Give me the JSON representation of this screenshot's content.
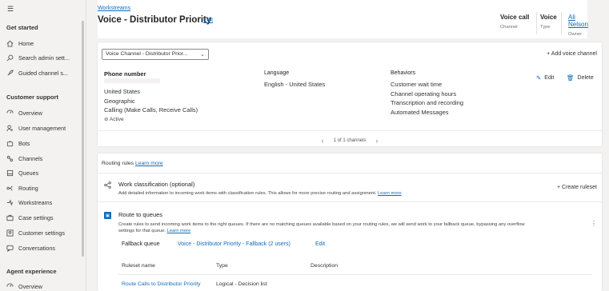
{
  "sidebar": {
    "hamburger": "☰",
    "sections": [
      {
        "title": "Get started",
        "items": [
          {
            "label": "Home",
            "icon": "home-icon"
          },
          {
            "label": "Search admin sett...",
            "icon": "search-icon"
          },
          {
            "label": "Guided channel s...",
            "icon": "rocket-icon"
          }
        ]
      },
      {
        "title": "Customer support",
        "items": [
          {
            "label": "Overview",
            "icon": "overview-icon"
          },
          {
            "label": "User management",
            "icon": "users-icon"
          },
          {
            "label": "Bots",
            "icon": "bot-icon"
          },
          {
            "label": "Channels",
            "icon": "channels-icon"
          },
          {
            "label": "Queues",
            "icon": "queue-icon"
          },
          {
            "label": "Routing",
            "icon": "routing-icon"
          },
          {
            "label": "Workstreams",
            "icon": "workstreams-icon"
          },
          {
            "label": "Case settings",
            "icon": "case-icon"
          },
          {
            "label": "Customer settings",
            "icon": "customer-icon"
          },
          {
            "label": "Conversations",
            "icon": "conversation-icon"
          }
        ]
      },
      {
        "title": "Agent experience",
        "items": [
          {
            "label": "Overview",
            "icon": "overview-icon"
          }
        ]
      }
    ]
  },
  "header": {
    "breadcrumb": "Workstreams",
    "title": "Voice - Distributor Priority",
    "edit_label": "Edit",
    "fields": [
      {
        "value": "Voice call",
        "label": "Channel"
      },
      {
        "value": "Voice",
        "label": "Type"
      },
      {
        "value": "Ali Nelson",
        "label": "Owner"
      }
    ]
  },
  "channel": {
    "dropdown_value": "Voice Channel - Distributor Prior...",
    "add_label": "Add voice channel",
    "phone_heading": "Phone number",
    "phone_lines": [
      "United States",
      "Geographic",
      "Calling (Make Calls, Receive Calls)"
    ],
    "status": "Active",
    "language_heading": "Language",
    "language_value": "English - United States",
    "behaviors_heading": "Behaviors",
    "behaviors": [
      "Customer wait time",
      "Channel operating hours",
      "Transcription and recording",
      "Automated Messages"
    ],
    "edit_label": "Edit",
    "delete_label": "Delete",
    "pager": "1 of 1 channels"
  },
  "routing": {
    "title": "Routing rules",
    "learn_more": "Learn more",
    "work_classification": {
      "title": "Work classification (optional)",
      "desc": "Add detailed information to incoming work items with classification rules. This allows for more precise routing and assignment.",
      "learn_more": "Learn more",
      "action": "Create ruleset"
    },
    "route_to_queues": {
      "title": "Route to queues",
      "desc1": "Create rules to send incoming work items to the right queues. If there are no matching queues available based on your routing rules, we will send work to your fallback queue, bypassing any overflow",
      "desc2": "settings for that queue.",
      "learn_more": "Learn more",
      "fallback_label": "Fallback queue",
      "fallback_value": "Voice - Distributor Priority - Fallback (2 users)",
      "fallback_edit": "Edit",
      "table_headers": [
        "Ruleset name",
        "Type",
        "Description"
      ],
      "rows": [
        {
          "name": "Route Calls to Distributor Priority",
          "type": "Logical - Decision list",
          "description": ""
        }
      ]
    }
  }
}
